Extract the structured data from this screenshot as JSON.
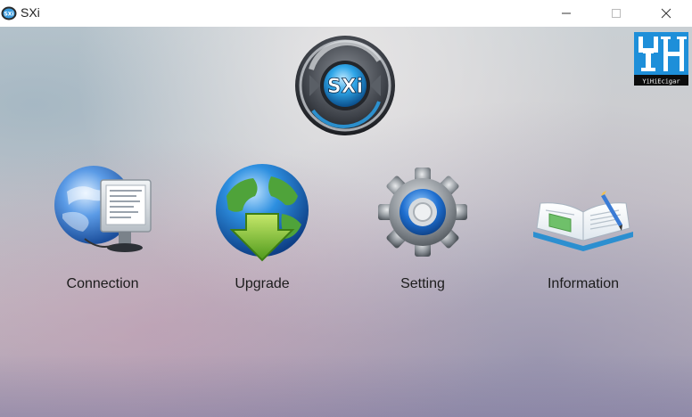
{
  "window": {
    "title": "SXi",
    "app_icon_text": "SXi"
  },
  "logo": {
    "text": "SXi",
    "icon": "sxi-logo-icon"
  },
  "brand": {
    "letters": "YH",
    "caption": "YiHiEcigar",
    "icon": "yihi-brand-logo"
  },
  "menu": [
    {
      "label": "Connection",
      "icon": "computer-globe-icon"
    },
    {
      "label": "Upgrade",
      "icon": "globe-download-icon"
    },
    {
      "label": "Setting",
      "icon": "gear-icon"
    },
    {
      "label": "Information",
      "icon": "open-book-icon"
    }
  ],
  "colors": {
    "brand_blue": "#1e8fd9",
    "upgrade_green": "#7ab82e",
    "gear_blue": "#1f6fd0"
  }
}
